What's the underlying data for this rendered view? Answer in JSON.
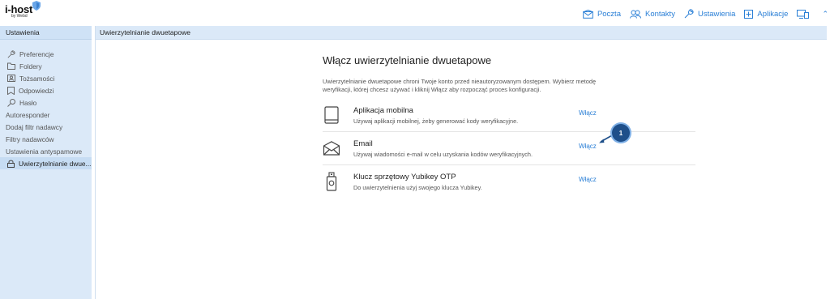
{
  "brand": {
    "name": "i-host",
    "sub": "by Webd"
  },
  "topnav": [
    {
      "label": "Poczta",
      "icon": "envelope-icon"
    },
    {
      "label": "Kontakty",
      "icon": "people-icon"
    },
    {
      "label": "Ustawienia",
      "icon": "wrench-icon"
    },
    {
      "label": "Aplikacje",
      "icon": "plus-box-icon"
    }
  ],
  "sidebar": {
    "title": "Ustawienia",
    "items": [
      {
        "label": "Preferencje",
        "icon": "wrench-icon"
      },
      {
        "label": "Foldery",
        "icon": "folder-icon"
      },
      {
        "label": "Tożsamości",
        "icon": "id-card-icon"
      },
      {
        "label": "Odpowiedzi",
        "icon": "note-icon"
      },
      {
        "label": "Hasło",
        "icon": "key-icon"
      },
      {
        "label": "Autoresponder",
        "icon": ""
      },
      {
        "label": "Dodaj filtr nadawcy",
        "icon": ""
      },
      {
        "label": "Filtry nadawców",
        "icon": ""
      },
      {
        "label": "Ustawienia antyspamowe",
        "icon": ""
      },
      {
        "label": "Uwierzytelnianie dwue...",
        "icon": "lock-icon",
        "active": true
      }
    ]
  },
  "panel": {
    "title": "Uwierzytelnianie dwuetapowe",
    "heading": "Włącz uwierzytelnianie dwuetapowe",
    "description": "Uwierzytelnianie dwuetapowe chroni Twoje konto przed nieautoryzowanym dostępem. Wybierz metodę weryfikacji, której chcesz używać i kliknij Włącz aby rozpocząć proces konfiguracji.",
    "methods": [
      {
        "title": "Aplikacja mobilna",
        "desc": "Używaj aplikacji mobilnej, żeby generować kody weryfikacyjne.",
        "action": "Włącz",
        "icon": "tablet-icon"
      },
      {
        "title": "Email",
        "desc": "Używaj wiadomości e-mail w celu uzyskania kodów weryfikacyjnych.",
        "action": "Włącz",
        "icon": "envelope-icon"
      },
      {
        "title": "Klucz sprzętowy Yubikey OTP",
        "desc": "Do uwierzytelnienia użyj swojego klucza Yubikey.",
        "action": "Włącz",
        "icon": "usb-key-icon"
      }
    ]
  },
  "annotation": {
    "label": "1"
  }
}
